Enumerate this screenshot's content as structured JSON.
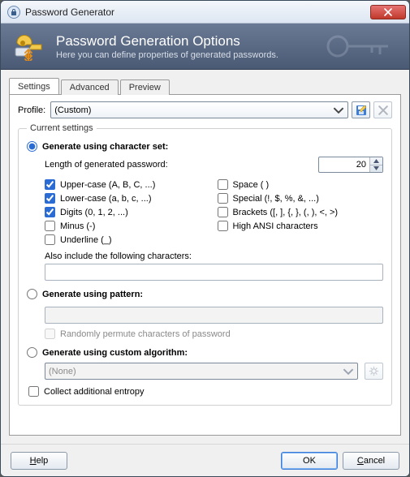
{
  "window": {
    "title": "Password Generator"
  },
  "banner": {
    "title": "Password Generation Options",
    "subtitle": "Here you can define properties of generated passwords."
  },
  "tabs": {
    "settings": "Settings",
    "advanced": "Advanced",
    "preview": "Preview"
  },
  "profile": {
    "label": "Profile:",
    "value": "(Custom)"
  },
  "group_legend": "Current settings",
  "gen_charset": {
    "label": "Generate using character set:",
    "length_label": "Length of generated password:",
    "length_value": "20",
    "checks": {
      "upper": {
        "label": "Upper-case (A, B, C, ...)",
        "checked": true
      },
      "space": {
        "label": "Space ( )",
        "checked": false
      },
      "lower": {
        "label": "Lower-case (a, b, c, ...)",
        "checked": true
      },
      "special": {
        "label": "Special (!, $, %, &, ...)",
        "checked": false
      },
      "digits": {
        "label": "Digits (0, 1, 2, ...)",
        "checked": true
      },
      "brackets": {
        "label": "Brackets ([, ], {, }, (, ), <, >)",
        "checked": false
      },
      "minus": {
        "label": "Minus (-)",
        "checked": false
      },
      "highansi": {
        "label": "High ANSI characters",
        "checked": false
      },
      "under": {
        "label": "Underline (_)",
        "checked": false
      }
    },
    "also_label": "Also include the following characters:",
    "also_value": ""
  },
  "gen_pattern": {
    "label": "Generate using pattern:",
    "value": "",
    "permute_label": "Randomly permute characters of password"
  },
  "gen_algo": {
    "label": "Generate using custom algorithm:",
    "value": "(None)"
  },
  "entropy_label": "Collect additional entropy",
  "footer": {
    "help": "Help",
    "ok": "OK",
    "cancel": "Cancel"
  }
}
